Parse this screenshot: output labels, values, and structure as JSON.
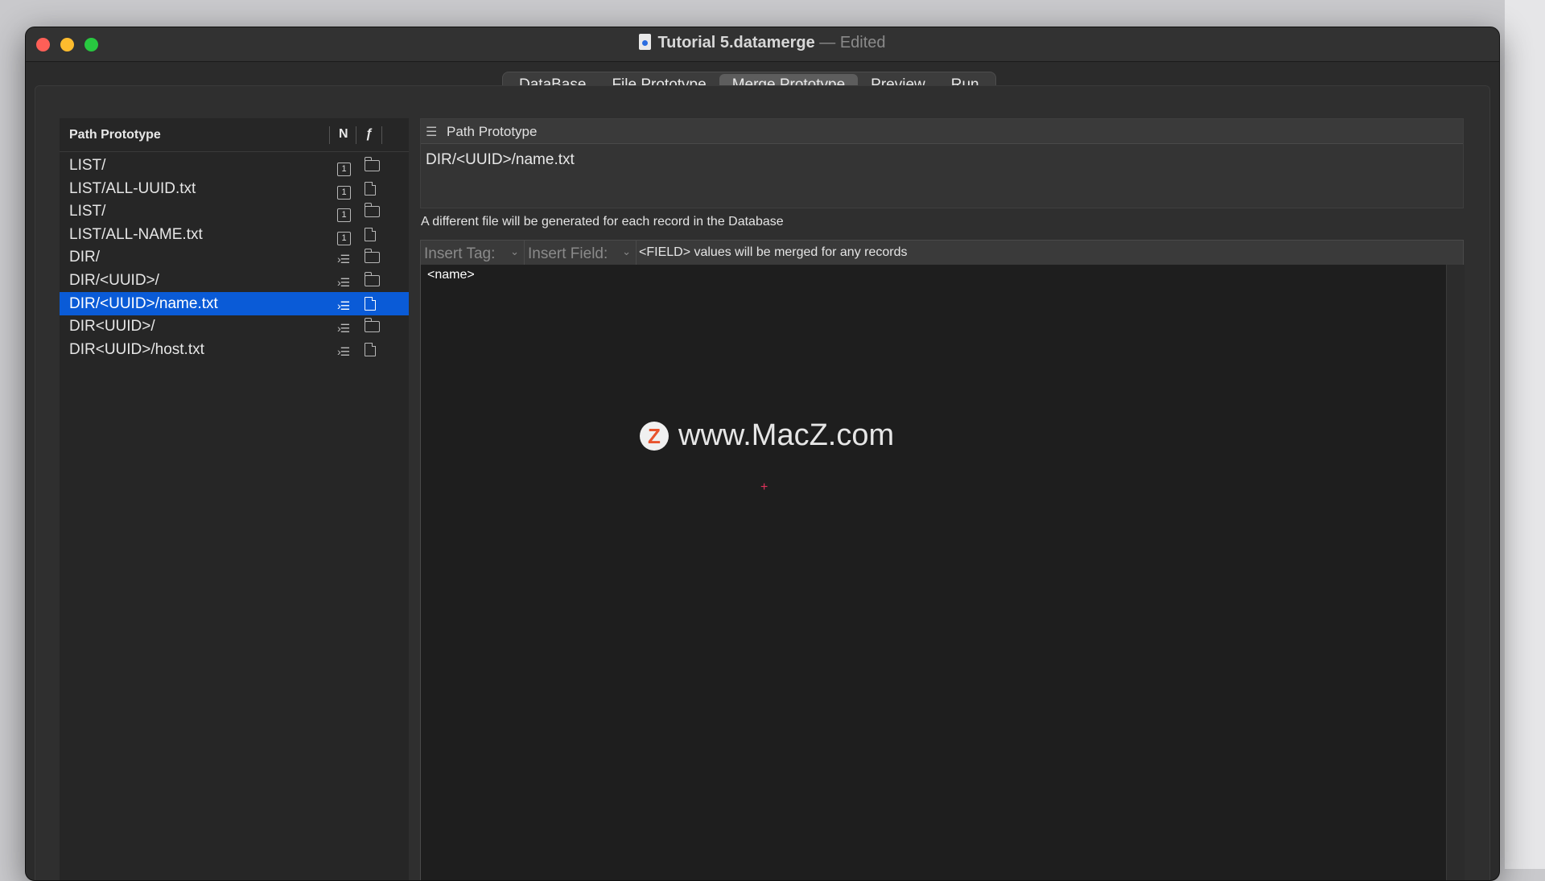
{
  "window": {
    "title": "Tutorial 5.datamerge",
    "separator": "—",
    "state": "Edited"
  },
  "tabs": [
    {
      "label": "DataBase",
      "selected": false
    },
    {
      "label": "File Prototype",
      "selected": false
    },
    {
      "label": "Merge Prototype",
      "selected": true
    },
    {
      "label": "Preview",
      "selected": false
    },
    {
      "label": "Run",
      "selected": false
    }
  ],
  "path_list": {
    "header": "Path Prototype",
    "col_n": "N",
    "col_f": "ƒ",
    "rows": [
      {
        "label": "LIST/",
        "type": "one-icon",
        "kind": "folder-icon"
      },
      {
        "label": "LIST/ALL-UUID.txt",
        "type": "one-icon",
        "kind": "file-icon"
      },
      {
        "label": "LIST/",
        "type": "one-icon",
        "kind": "folder-icon"
      },
      {
        "label": "LIST/ALL-NAME.txt",
        "type": "one-icon",
        "kind": "file-icon"
      },
      {
        "label": "DIR/",
        "type": "each-icon",
        "kind": "folder-icon"
      },
      {
        "label": "DIR/<UUID>/",
        "type": "each-icon",
        "kind": "folder-icon"
      },
      {
        "label": "DIR/<UUID>/name.txt",
        "type": "each-icon",
        "kind": "file-icon",
        "selected": true
      },
      {
        "label": "DIR<UUID>/",
        "type": "each-icon",
        "kind": "folder-icon"
      },
      {
        "label": "DIR<UUID>/host.txt",
        "type": "each-icon",
        "kind": "file-icon"
      }
    ],
    "one_glyph": "1",
    "each_glyph": "›☰"
  },
  "path_box": {
    "title": "Path Prototype",
    "value": "DIR/<UUID>/name.txt"
  },
  "info_text": "A different file will be generated for each record in the Database",
  "toolbar": {
    "insert_tag": "Insert Tag:",
    "insert_field": "Insert Field:",
    "note": "<FIELD> values will be merged for any records"
  },
  "editor": {
    "content": "<name>"
  },
  "watermark": {
    "badge": "Z",
    "text": "www.MacZ.com"
  },
  "colors": {
    "selection": "#0a5bd7",
    "close": "#fe5f57",
    "minimize": "#febc2e",
    "maximize": "#28c840"
  }
}
